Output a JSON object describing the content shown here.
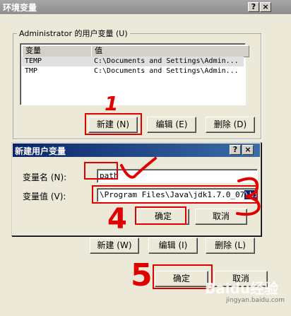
{
  "outer_window": {
    "title": "环境变量",
    "help_button": "?",
    "close_button": "×"
  },
  "user_vars": {
    "group_label": "Administrator 的用户变量 (U)",
    "columns": [
      "变量",
      "值"
    ],
    "rows": [
      {
        "name": "TEMP",
        "value": "C:\\Documents and Settings\\Admin..."
      },
      {
        "name": "TMP",
        "value": "C:\\Documents and Settings\\Admin..."
      }
    ],
    "buttons": {
      "new": "新建 (N)",
      "edit": "编辑 (E)",
      "delete": "删除 (D)"
    }
  },
  "new_var_dialog": {
    "title": "新建用户变量",
    "help_button": "?",
    "close_button": "×",
    "name_label": "变量名 (N):",
    "name_value": "path",
    "value_label": "变量值 (V):",
    "value_text": "\\Program Files\\Java\\jdk1.7.0_07",
    "value_text_selected": "\\bi",
    "ok_button": "确定",
    "cancel_button": "取消"
  },
  "system_vars": {
    "buttons": {
      "new": "新建 (W)",
      "edit": "编辑 (I)",
      "delete": "删除 (L)"
    }
  },
  "bottom_buttons": {
    "ok": "确定",
    "cancel": "取消"
  },
  "annotations": {
    "step1": "1",
    "step4": "4",
    "step5": "5",
    "mark_color": "#e00000"
  },
  "watermark": {
    "brand": "Baidu经验",
    "url": "jingyan.baidu.com"
  }
}
